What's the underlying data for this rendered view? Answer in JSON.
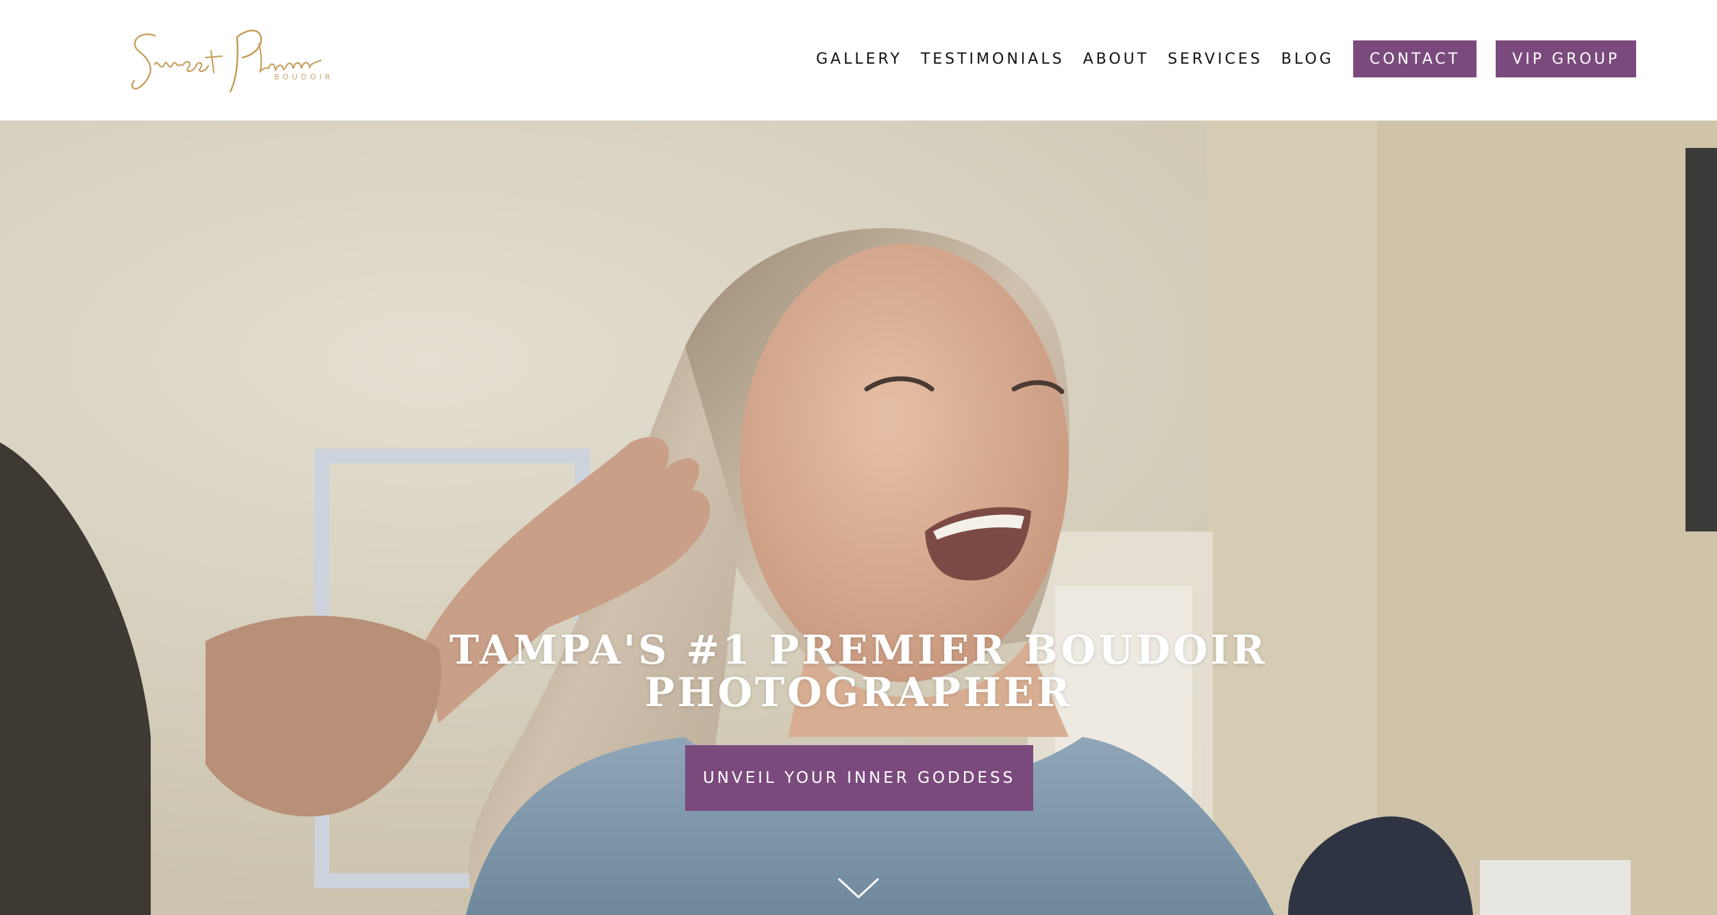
{
  "logo": {
    "script": "Sweet Plum",
    "sub": "BOUDOIR"
  },
  "nav": {
    "links": [
      "GALLERY",
      "TESTIMONIALS",
      "ABOUT",
      "SERVICES",
      "BLOG"
    ],
    "contact_label": "CONTACT",
    "vip_label": "VIP GROUP"
  },
  "hero": {
    "title_line1": "TAMPA'S #1 PREMIER BOUDOIR",
    "title_line2": "PHOTOGRAPHER",
    "cta_label": "UNVEIL YOUR INNER GODDESS",
    "scroll_icon": "chevron-down-icon"
  },
  "colors": {
    "brand_purple": "#7b4a7d",
    "logo_gold": "#c49a54",
    "header_bg": "#ffffff",
    "hero_text": "#ffffff"
  }
}
